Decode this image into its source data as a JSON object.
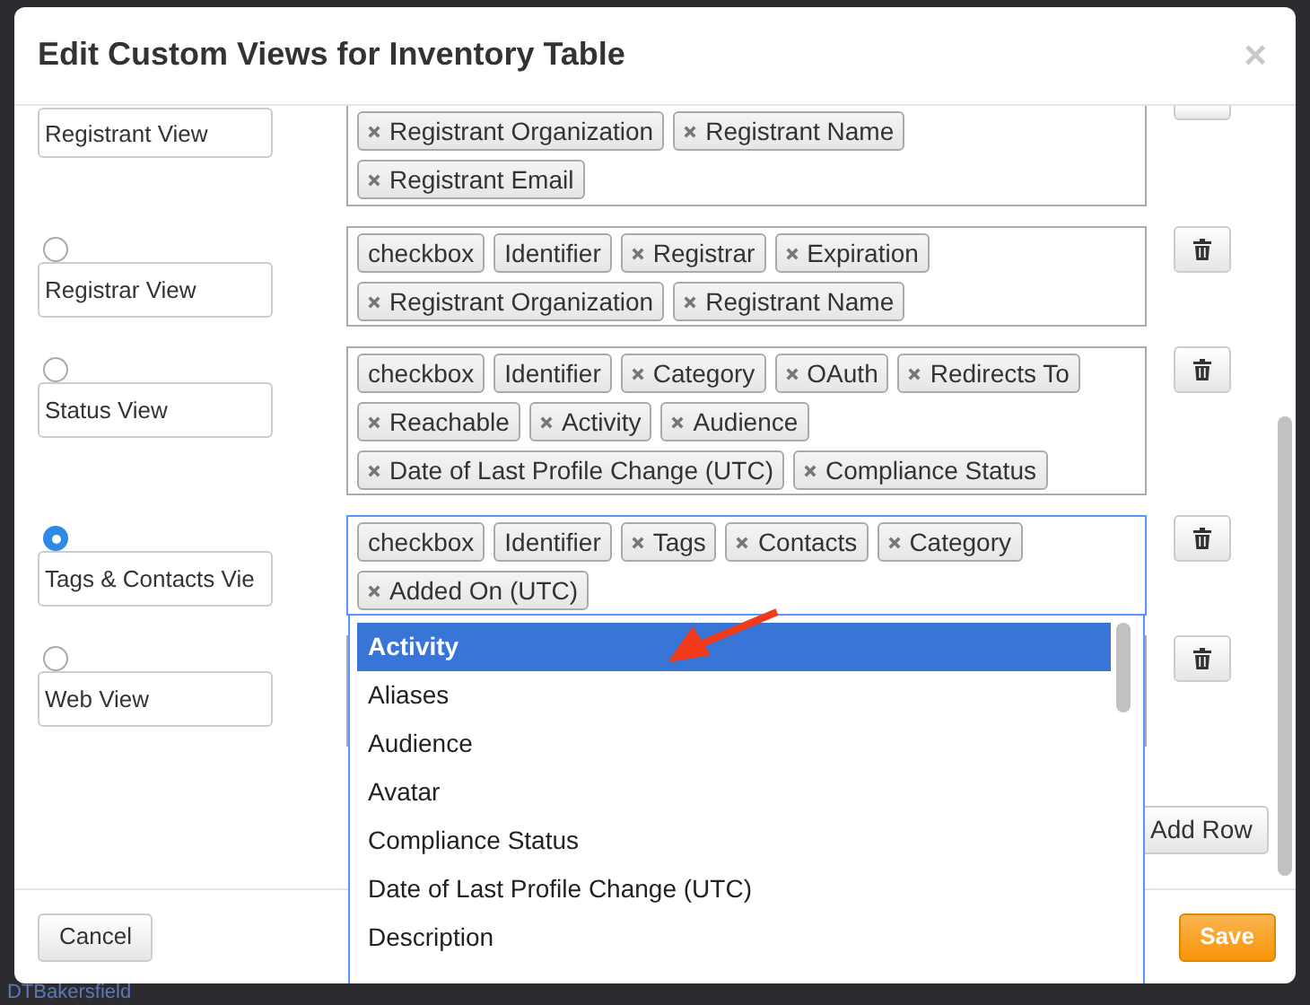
{
  "background": {
    "text": "DTBakersfield"
  },
  "dialog": {
    "title": "Edit Custom Views for Inventory Table",
    "close": "×"
  },
  "views": [
    {
      "kind": "cut",
      "name": "Registrant View",
      "selected": false,
      "columns": [
        {
          "label": "Registrant Organization",
          "removable": true
        },
        {
          "label": "Registrant Name",
          "removable": true
        },
        {
          "label": "Registrant Email",
          "removable": true
        }
      ]
    },
    {
      "kind": "full",
      "name": "Registrar View",
      "selected": false,
      "columns": [
        {
          "label": "checkbox",
          "removable": false
        },
        {
          "label": "Identifier",
          "removable": false
        },
        {
          "label": "Registrar",
          "removable": true
        },
        {
          "label": "Expiration",
          "removable": true
        },
        {
          "label": "Registrant Organization",
          "removable": true
        },
        {
          "label": "Registrant Name",
          "removable": true
        }
      ]
    },
    {
      "kind": "full",
      "name": "Status View",
      "selected": false,
      "columns": [
        {
          "label": "checkbox",
          "removable": false
        },
        {
          "label": "Identifier",
          "removable": false
        },
        {
          "label": "Category",
          "removable": true
        },
        {
          "label": "OAuth",
          "removable": true
        },
        {
          "label": "Redirects To",
          "removable": true
        },
        {
          "label": "Reachable",
          "removable": true
        },
        {
          "label": "Activity",
          "removable": true
        },
        {
          "label": "Audience",
          "removable": true
        },
        {
          "label": "Date of Last Profile Change (UTC)",
          "removable": true
        },
        {
          "label": "Compliance Status",
          "removable": true
        }
      ]
    },
    {
      "kind": "full",
      "name": "Tags & Contacts Vie",
      "selected": true,
      "columns": [
        {
          "label": "checkbox",
          "removable": false
        },
        {
          "label": "Identifier",
          "removable": false
        },
        {
          "label": "Tags",
          "removable": true
        },
        {
          "label": "Contacts",
          "removable": true
        },
        {
          "label": "Category",
          "removable": true
        },
        {
          "label": "Added On (UTC)",
          "removable": true
        }
      ]
    },
    {
      "kind": "full",
      "name": "Web View",
      "selected": false
    }
  ],
  "add_row": "Add Row",
  "column_dropdown": {
    "options": [
      {
        "label": "Activity",
        "selected": true
      },
      {
        "label": "Aliases",
        "selected": false
      },
      {
        "label": "Audience",
        "selected": false
      },
      {
        "label": "Avatar",
        "selected": false
      },
      {
        "label": "Compliance Status",
        "selected": false
      },
      {
        "label": "Date of Last Profile Change (UTC)",
        "selected": false
      },
      {
        "label": "Description",
        "selected": false
      }
    ]
  },
  "buttons": {
    "cancel": "Cancel",
    "save": "Save"
  }
}
